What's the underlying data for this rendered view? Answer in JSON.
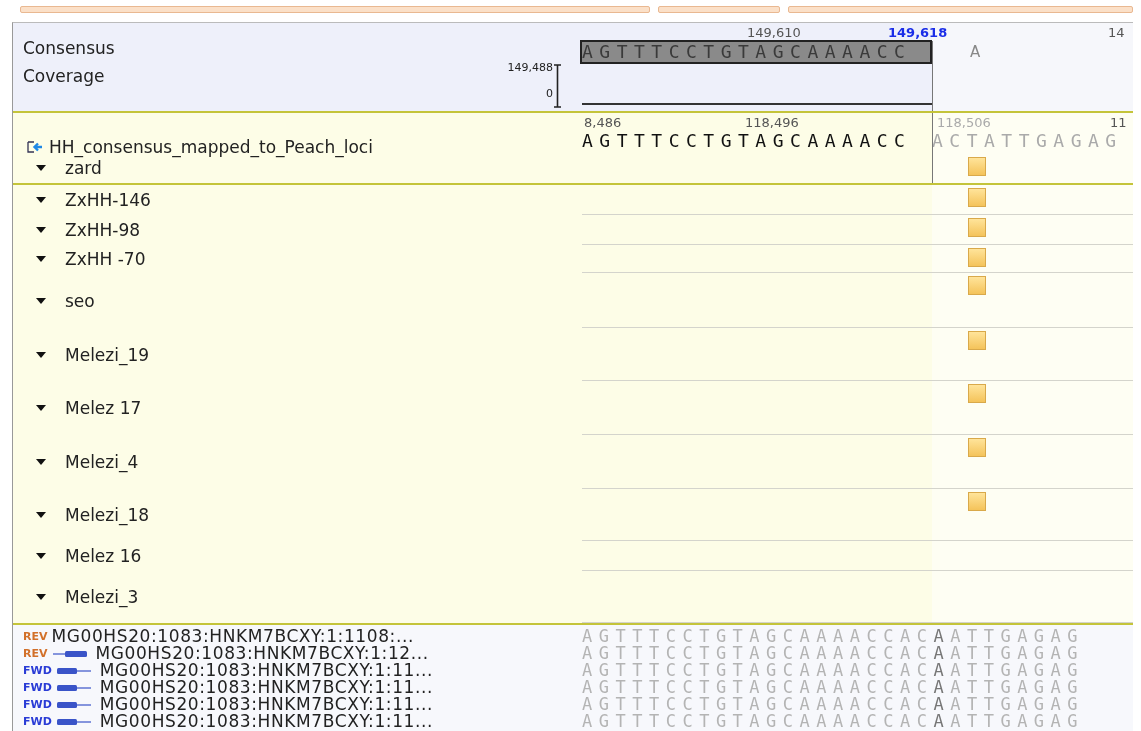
{
  "consensus": {
    "label": "Consensus",
    "ruler": [
      {
        "label": "149,610",
        "current": false
      },
      {
        "label": "149,618",
        "current": true
      },
      {
        "label": "14",
        "current": false
      }
    ],
    "sequence": "AGTTTCCTGTAGCAAAACC",
    "selected": true,
    "next_base": "A"
  },
  "coverage": {
    "label": "Coverage",
    "max": "149,488",
    "min": "0"
  },
  "track": {
    "name": "HH_consensus_mapped_to_Peach_loci",
    "ruler": [
      "8,486",
      "118,496",
      "118,506",
      "11"
    ],
    "sequence": "AGTTTCCTGTAGCAAAACC",
    "sequence_after": "ACTATTGAGAG"
  },
  "samples": [
    {
      "name": "zard",
      "expanded": true,
      "variant": true
    },
    {
      "name": "ZxHH-146",
      "expanded": true,
      "variant": true
    },
    {
      "name": "ZxHH-98",
      "expanded": true,
      "variant": true
    },
    {
      "name": "ZxHH -70",
      "expanded": true,
      "variant": true
    },
    {
      "name": "seo",
      "expanded": true,
      "variant": true
    },
    {
      "name": "Melezi_19",
      "expanded": true,
      "variant": true
    },
    {
      "name": "Melez 17",
      "expanded": true,
      "variant": true
    },
    {
      "name": "Melezi_4",
      "expanded": true,
      "variant": true
    },
    {
      "name": "Melezi_18",
      "expanded": true,
      "variant": true
    },
    {
      "name": "Melez 16",
      "expanded": true,
      "variant": false
    },
    {
      "name": "Melezi_3",
      "expanded": true,
      "variant": false
    }
  ],
  "reads": [
    {
      "strand": "REV",
      "kind": "rev",
      "arrow": false,
      "name": "MG00HS20:1083:HNKM7BCXY:1:1108:...",
      "sequence": "AGTTTCCTGTAGCAAAACCAC",
      "base": "A",
      "sequence_after": "ATTGAGAG"
    },
    {
      "strand": "REV",
      "kind": "rev",
      "arrow": true,
      "name": "MG00HS20:1083:HNKM7BCXY:1:12...",
      "sequence": "AGTTTCCTGTAGCAAAACCAC",
      "base": "A",
      "sequence_after": "ATTGAGAG"
    },
    {
      "strand": "FWD",
      "kind": "fwd",
      "arrow": true,
      "name": "MG00HS20:1083:HNKM7BCXY:1:11...",
      "sequence": "AGTTTCCTGTAGCAAAACCAC",
      "base": "A",
      "sequence_after": "ATTGAGAG"
    },
    {
      "strand": "FWD",
      "kind": "fwd",
      "arrow": true,
      "name": "MG00HS20:1083:HNKM7BCXY:1:11...",
      "sequence": "AGTTTCCTGTAGCAAAACCAC",
      "base": "A",
      "sequence_after": "ATTGAGAG"
    },
    {
      "strand": "FWD",
      "kind": "fwd",
      "arrow": true,
      "name": "MG00HS20:1083:HNKM7BCXY:1:11...",
      "sequence": "AGTTTCCTGTAGCAAAACCAC",
      "base": "A",
      "sequence_after": "ATTGAGAG"
    },
    {
      "strand": "FWD",
      "kind": "fwd",
      "arrow": true,
      "name": "MG00HS20:1083:HNKM7BCXY:1:11...",
      "sequence": "AGTTTCCTGTAGCAAAACCAC",
      "base": "A",
      "sequence_after": "ATTGAGAG"
    }
  ]
}
